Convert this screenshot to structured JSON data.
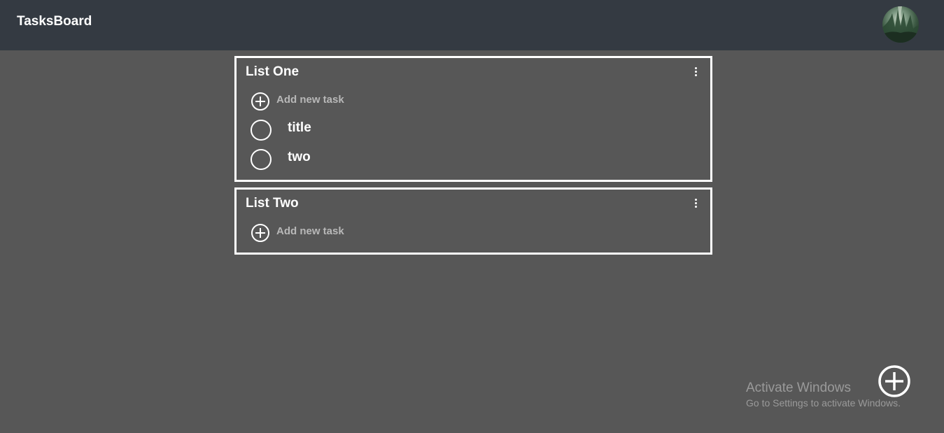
{
  "app": {
    "title": "TasksBoard"
  },
  "header": {
    "avatar": "user-avatar-image"
  },
  "lists": [
    {
      "title": "List One",
      "add_task_label": "Add new task",
      "tasks": [
        {
          "title": "title"
        },
        {
          "title": "two"
        }
      ]
    },
    {
      "title": "List Two",
      "add_task_label": "Add new task",
      "tasks": []
    }
  ],
  "watermark": {
    "title": "Activate Windows",
    "subtitle": "Go to Settings to activate Windows."
  },
  "colors": {
    "background": "#575757",
    "header": "#343a42",
    "border": "#ffffff",
    "muted_text": "#b8b8b8"
  },
  "icons": {
    "add": "plus-circle-icon",
    "menu": "more-vertical-icon",
    "checkbox": "circle-outline-icon"
  }
}
